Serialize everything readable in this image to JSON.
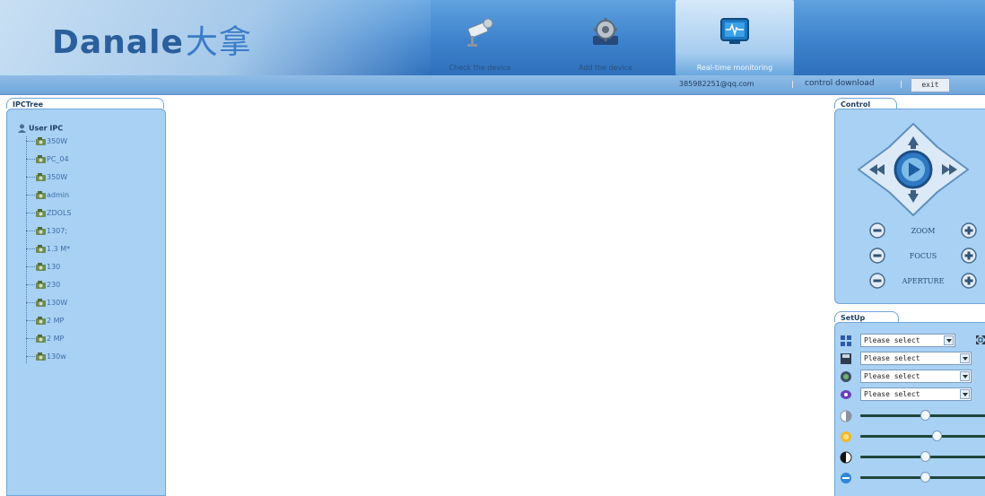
{
  "brand": {
    "logo_latin": "Danale",
    "logo_cn": "大拿"
  },
  "nav": [
    {
      "label": "Check the device",
      "icon": "camera-icon"
    },
    {
      "label": "Add the device",
      "icon": "gear-icon"
    },
    {
      "label": "Real-time monitoring",
      "icon": "monitor-icon",
      "active": true
    }
  ],
  "userbar": {
    "email": "385982251@qq.com",
    "separator": "|",
    "download": "control download",
    "exit": "exit"
  },
  "tree": {
    "tab": "IPCTree",
    "root": "User IPC",
    "items": [
      "350W",
      "PC_04",
      "350W",
      "admin",
      "ZDOLS",
      "1307;",
      "1.3 M*",
      "130",
      "230",
      "130W",
      "2 MP",
      "2 MP",
      "130w"
    ]
  },
  "control": {
    "tab": "Control",
    "rows": [
      "ZOOM",
      "FOCUS",
      "APERTURE"
    ]
  },
  "setup": {
    "tab": "SetUp",
    "selects": [
      {
        "icon": "layout-grid-icon",
        "value": "Please select"
      },
      {
        "icon": "save-icon",
        "value": "Please select"
      },
      {
        "icon": "record-icon",
        "value": "Please select"
      },
      {
        "icon": "eye-icon",
        "value": "Please select"
      }
    ],
    "sliders": [
      {
        "icon": "contrast-icon",
        "level": 0.5
      },
      {
        "icon": "brightness-icon",
        "level": 0.6
      },
      {
        "icon": "saturation-icon",
        "level": 0.5
      },
      {
        "icon": "hue-icon",
        "level": 0.5
      }
    ]
  },
  "colors": {
    "header": "#3d82cc",
    "panel": "#a8d1f4",
    "tree_text": "#3d6ea8"
  }
}
